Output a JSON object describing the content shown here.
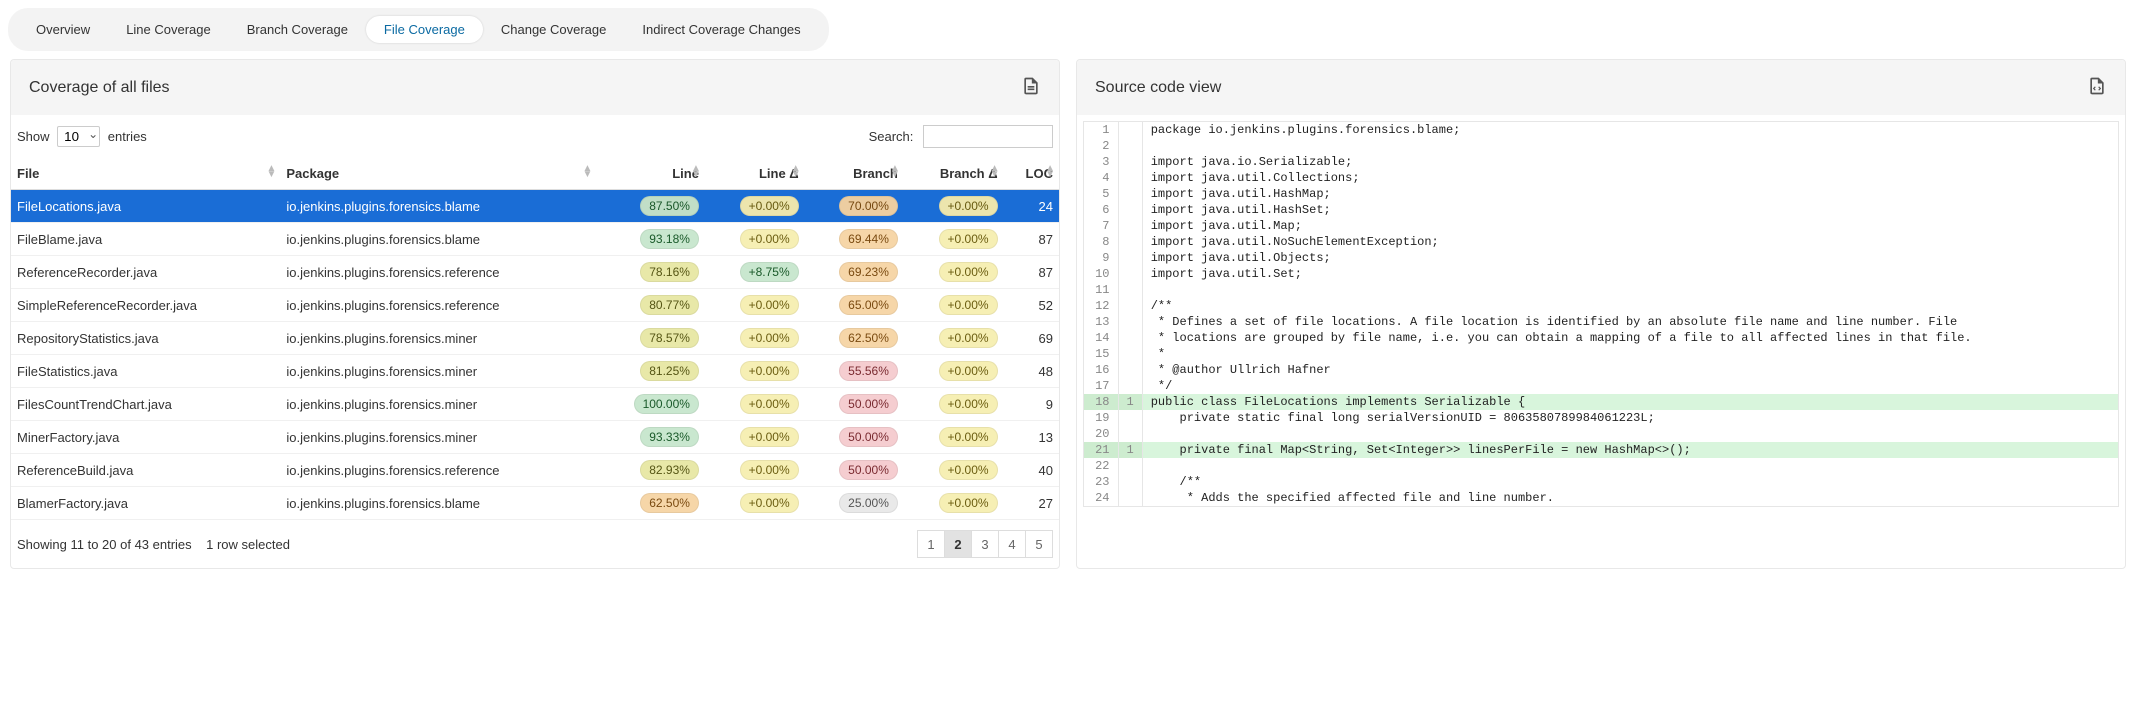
{
  "tabs": {
    "items": [
      {
        "label": "Overview",
        "active": false
      },
      {
        "label": "Line Coverage",
        "active": false
      },
      {
        "label": "Branch Coverage",
        "active": false
      },
      {
        "label": "File Coverage",
        "active": true
      },
      {
        "label": "Change Coverage",
        "active": false
      },
      {
        "label": "Indirect Coverage Changes",
        "active": false
      }
    ]
  },
  "leftPanel": {
    "title": "Coverage of all files",
    "show_label_pre": "Show",
    "show_label_post": "entries",
    "show_value": "10",
    "search_label": "Search:",
    "search_value": "",
    "columns": [
      "File",
      "Package",
      "Line",
      "Line Δ",
      "Branch",
      "Branch Δ",
      "LOC"
    ],
    "rows": [
      {
        "selected": true,
        "file": "FileLocations.java",
        "pkg": "io.jenkins.plugins.forensics.blame",
        "line": "87.50%",
        "lineCls": "green",
        "lineD": "+0.00%",
        "lineDCls": "yellow",
        "branch": "70.00%",
        "branchCls": "orange",
        "branchD": "+0.00%",
        "branchDCls": "yellow",
        "loc": "24"
      },
      {
        "selected": false,
        "file": "FileBlame.java",
        "pkg": "io.jenkins.plugins.forensics.blame",
        "line": "93.18%",
        "lineCls": "green",
        "lineD": "+0.00%",
        "lineDCls": "yellow",
        "branch": "69.44%",
        "branchCls": "orange",
        "branchD": "+0.00%",
        "branchDCls": "yellow",
        "loc": "87"
      },
      {
        "selected": false,
        "file": "ReferenceRecorder.java",
        "pkg": "io.jenkins.plugins.forensics.reference",
        "line": "78.16%",
        "lineCls": "yellowG",
        "lineD": "+8.75%",
        "lineDCls": "green",
        "branch": "69.23%",
        "branchCls": "orange",
        "branchD": "+0.00%",
        "branchDCls": "yellow",
        "loc": "87"
      },
      {
        "selected": false,
        "file": "SimpleReferenceRecorder.java",
        "pkg": "io.jenkins.plugins.forensics.reference",
        "line": "80.77%",
        "lineCls": "yellowG",
        "lineD": "+0.00%",
        "lineDCls": "yellow",
        "branch": "65.00%",
        "branchCls": "orange",
        "branchD": "+0.00%",
        "branchDCls": "yellow",
        "loc": "52"
      },
      {
        "selected": false,
        "file": "RepositoryStatistics.java",
        "pkg": "io.jenkins.plugins.forensics.miner",
        "line": "78.57%",
        "lineCls": "yellowG",
        "lineD": "+0.00%",
        "lineDCls": "yellow",
        "branch": "62.50%",
        "branchCls": "orange",
        "branchD": "+0.00%",
        "branchDCls": "yellow",
        "loc": "69"
      },
      {
        "selected": false,
        "file": "FileStatistics.java",
        "pkg": "io.jenkins.plugins.forensics.miner",
        "line": "81.25%",
        "lineCls": "yellowG",
        "lineD": "+0.00%",
        "lineDCls": "yellow",
        "branch": "55.56%",
        "branchCls": "pink",
        "branchD": "+0.00%",
        "branchDCls": "yellow",
        "loc": "48"
      },
      {
        "selected": false,
        "file": "FilesCountTrendChart.java",
        "pkg": "io.jenkins.plugins.forensics.miner",
        "line": "100.00%",
        "lineCls": "green",
        "lineD": "+0.00%",
        "lineDCls": "yellow",
        "branch": "50.00%",
        "branchCls": "pink",
        "branchD": "+0.00%",
        "branchDCls": "yellow",
        "loc": "9"
      },
      {
        "selected": false,
        "file": "MinerFactory.java",
        "pkg": "io.jenkins.plugins.forensics.miner",
        "line": "93.33%",
        "lineCls": "green",
        "lineD": "+0.00%",
        "lineDCls": "yellow",
        "branch": "50.00%",
        "branchCls": "pink",
        "branchD": "+0.00%",
        "branchDCls": "yellow",
        "loc": "13"
      },
      {
        "selected": false,
        "file": "ReferenceBuild.java",
        "pkg": "io.jenkins.plugins.forensics.reference",
        "line": "82.93%",
        "lineCls": "yellowG",
        "lineD": "+0.00%",
        "lineDCls": "yellow",
        "branch": "50.00%",
        "branchCls": "pink",
        "branchD": "+0.00%",
        "branchDCls": "yellow",
        "loc": "40"
      },
      {
        "selected": false,
        "file": "BlamerFactory.java",
        "pkg": "io.jenkins.plugins.forensics.blame",
        "line": "62.50%",
        "lineCls": "orange",
        "lineD": "+0.00%",
        "lineDCls": "yellow",
        "branch": "25.00%",
        "branchCls": "grey",
        "branchD": "+0.00%",
        "branchDCls": "yellow",
        "loc": "27"
      }
    ],
    "footer_info": "Showing 11 to 20 of 43 entries",
    "footer_sel": "1 row selected",
    "pages": [
      "1",
      "2",
      "3",
      "4",
      "5"
    ],
    "current_page": "2"
  },
  "rightPanel": {
    "title": "Source code view",
    "code": [
      {
        "n": 1,
        "h": "",
        "cov": false,
        "src": "package io.jenkins.plugins.forensics.blame;"
      },
      {
        "n": 2,
        "h": "",
        "cov": false,
        "src": ""
      },
      {
        "n": 3,
        "h": "",
        "cov": false,
        "src": "import java.io.Serializable;"
      },
      {
        "n": 4,
        "h": "",
        "cov": false,
        "src": "import java.util.Collections;"
      },
      {
        "n": 5,
        "h": "",
        "cov": false,
        "src": "import java.util.HashMap;"
      },
      {
        "n": 6,
        "h": "",
        "cov": false,
        "src": "import java.util.HashSet;"
      },
      {
        "n": 7,
        "h": "",
        "cov": false,
        "src": "import java.util.Map;"
      },
      {
        "n": 8,
        "h": "",
        "cov": false,
        "src": "import java.util.NoSuchElementException;"
      },
      {
        "n": 9,
        "h": "",
        "cov": false,
        "src": "import java.util.Objects;"
      },
      {
        "n": 10,
        "h": "",
        "cov": false,
        "src": "import java.util.Set;"
      },
      {
        "n": 11,
        "h": "",
        "cov": false,
        "src": ""
      },
      {
        "n": 12,
        "h": "",
        "cov": false,
        "src": "/**"
      },
      {
        "n": 13,
        "h": "",
        "cov": false,
        "src": " * Defines a set of file locations. A file location is identified by an absolute file name and line number. File"
      },
      {
        "n": 14,
        "h": "",
        "cov": false,
        "src": " * locations are grouped by file name, i.e. you can obtain a mapping of a file to all affected lines in that file."
      },
      {
        "n": 15,
        "h": "",
        "cov": false,
        "src": " *"
      },
      {
        "n": 16,
        "h": "",
        "cov": false,
        "src": " * @author Ullrich Hafner"
      },
      {
        "n": 17,
        "h": "",
        "cov": false,
        "src": " */"
      },
      {
        "n": 18,
        "h": "1",
        "cov": true,
        "src": "public class FileLocations implements Serializable {"
      },
      {
        "n": 19,
        "h": "",
        "cov": false,
        "src": "    private static final long serialVersionUID = 8063580789984061223L;"
      },
      {
        "n": 20,
        "h": "",
        "cov": false,
        "src": ""
      },
      {
        "n": 21,
        "h": "1",
        "cov": true,
        "src": "    private final Map<String, Set<Integer>> linesPerFile = new HashMap<>();"
      },
      {
        "n": 22,
        "h": "",
        "cov": false,
        "src": ""
      },
      {
        "n": 23,
        "h": "",
        "cov": false,
        "src": "    /**"
      },
      {
        "n": 24,
        "h": "",
        "cov": false,
        "src": "     * Adds the specified affected file and line number."
      }
    ]
  }
}
